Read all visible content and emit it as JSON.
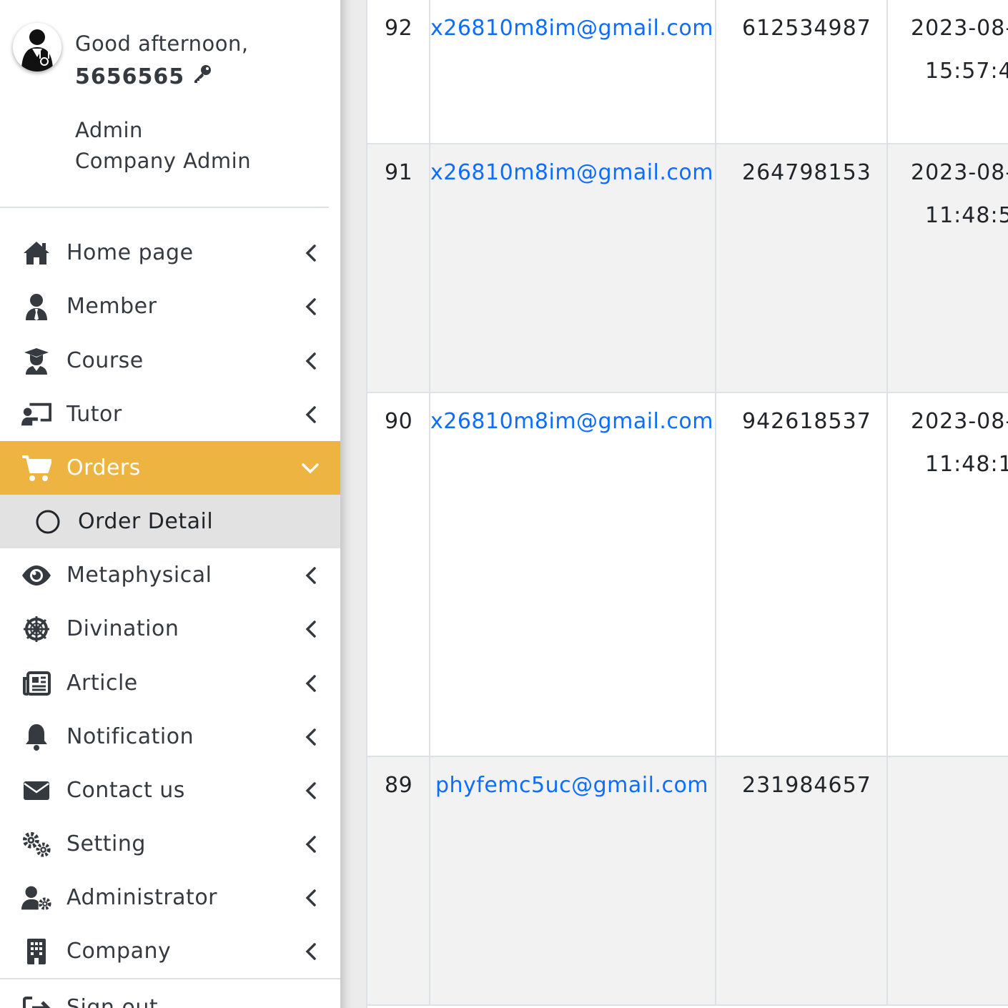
{
  "user": {
    "greeting": "Good afternoon,",
    "name": "5656565",
    "role": "Admin",
    "company_role": "Company Admin"
  },
  "sidebar": {
    "items": [
      {
        "label": "Home page",
        "icon": "home-icon"
      },
      {
        "label": "Member",
        "icon": "user-tie-icon"
      },
      {
        "label": "Course",
        "icon": "graduate-icon"
      },
      {
        "label": "Tutor",
        "icon": "chalkboard-teacher-icon"
      },
      {
        "label": "Orders",
        "icon": "cart-icon",
        "active": true
      },
      {
        "label": "Order Detail",
        "icon": "circle-icon",
        "sub": true
      },
      {
        "label": "Metaphysical",
        "icon": "eye-icon"
      },
      {
        "label": "Divination",
        "icon": "dharma-wheel-icon"
      },
      {
        "label": "Article",
        "icon": "newspaper-icon"
      },
      {
        "label": "Notification",
        "icon": "bell-icon"
      },
      {
        "label": "Contact us",
        "icon": "envelope-icon"
      },
      {
        "label": "Setting",
        "icon": "cogs-icon"
      },
      {
        "label": "Administrator",
        "icon": "user-cog-icon"
      },
      {
        "label": "Company",
        "icon": "building-icon"
      },
      {
        "label": "Sign out",
        "icon": "sign-out-icon"
      }
    ]
  },
  "orders": {
    "rows": [
      {
        "id": "92",
        "email": "x26810m8im@gmail.com",
        "code": "612534987",
        "date": "2023-08-",
        "time": "15:57:4"
      },
      {
        "id": "91",
        "email": "x26810m8im@gmail.com",
        "code": "264798153",
        "date": "2023-08-",
        "time": "11:48:5"
      },
      {
        "id": "90",
        "email": "x26810m8im@gmail.com",
        "code": "942618537",
        "date": "2023-08-",
        "time": "11:48:1"
      },
      {
        "id": "89",
        "email": "phyfemc5uc@gmail.com",
        "code": "231984657",
        "date": "",
        "time": ""
      }
    ]
  },
  "colors": {
    "active_bg": "#eeb441",
    "link": "#0d6efd",
    "text": "#343a40"
  }
}
